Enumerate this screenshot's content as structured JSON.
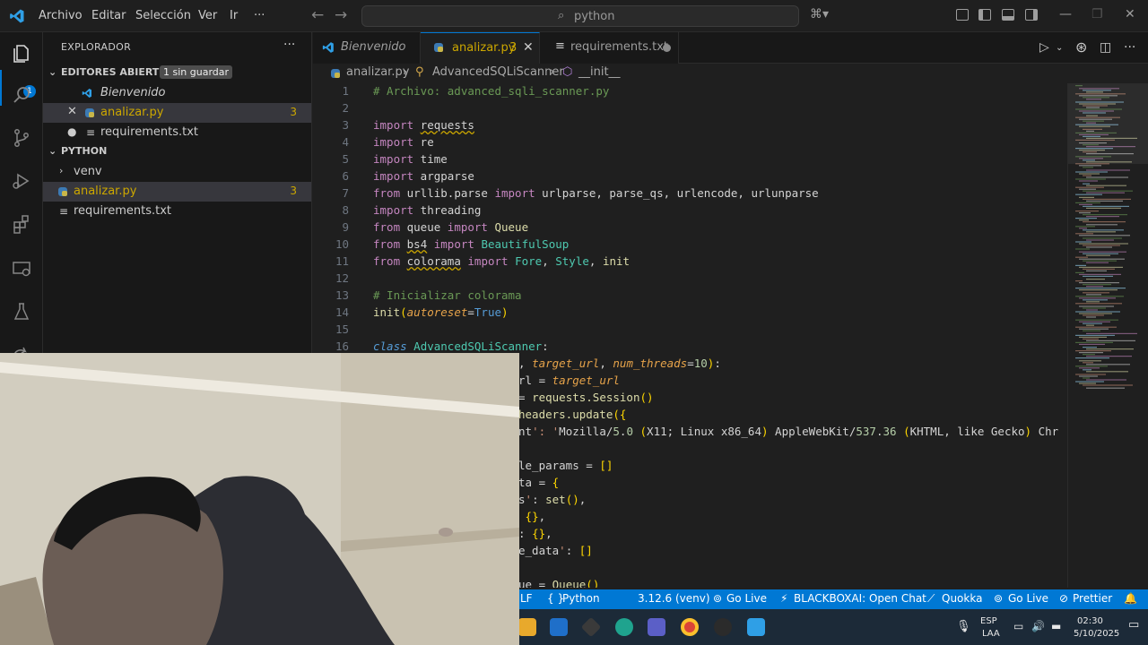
{
  "titlebar": {
    "menus": [
      "Archivo",
      "Editar",
      "Selección",
      "Ver",
      "Ir",
      "···"
    ],
    "search_text": "python"
  },
  "activitybar": {
    "explorer_badge": "1"
  },
  "sidebar": {
    "title": "EXPLORADOR",
    "open_editors": {
      "label": "EDITORES ABIERTOS",
      "dirty_badge": "1 sin guardar",
      "items": [
        {
          "name": "Bienvenido",
          "count": ""
        },
        {
          "name": "analizar.py",
          "count": "3"
        },
        {
          "name": "requirements.txt",
          "count": ""
        }
      ]
    },
    "folder": {
      "label": "PYTHON",
      "items": [
        {
          "name": "venv",
          "count": ""
        },
        {
          "name": "analizar.py",
          "count": "3"
        },
        {
          "name": "requirements.txt",
          "count": ""
        }
      ]
    }
  },
  "tabs": [
    {
      "label": "Bienvenido"
    },
    {
      "label": "analizar.py",
      "count": "3"
    },
    {
      "label": "requirements.txt"
    }
  ],
  "breadcrumb": {
    "file": "analizar.py",
    "class": "AdvancedSQLiScanner",
    "method": "__init__"
  },
  "editor": {
    "line_numbers": [
      "1",
      "2",
      "3",
      "4",
      "5",
      "6",
      "7",
      "8",
      "9",
      "10",
      "11",
      "12",
      "13",
      "14",
      "15",
      "16"
    ],
    "lines": [
      "# Archivo: advanced_sqli_scanner.py",
      "",
      "import requests",
      "import re",
      "import time",
      "import argparse",
      "from urllib.parse import urlparse, parse_qs, urlencode, urlunparse",
      "import threading",
      "from queue import Queue",
      "from bs4 import BeautifulSoup",
      "from colorama import Fore, Style, init",
      "",
      "# Inicializar colorama",
      "init(autoreset=True)",
      "",
      "class AdvancedSQLiScanner:",
      ", target_url, num_threads=10):",
      "rl = target_url",
      "= requests.Session()",
      "headers.update({",
      "nt': 'Mozilla/5.0 (X11; Linux x86_64) AppleWebKit/537.36 (KHTML, like Gecko) Chr",
      "",
      "le_params = []",
      "ta = {",
      "s': set(),",
      " {},",
      ": {},",
      "e_data': []",
      "",
      "ue = Queue()"
    ]
  },
  "statusbar": {
    "items": [
      "LF",
      "Python",
      "3.12.6 (venv)",
      "Go Live",
      "BLACKBOXAI: Open Chat",
      "Quokka",
      "Go Live",
      "Prettier"
    ]
  },
  "taskbar": {
    "lang": "ESP",
    "lang2": "LAA",
    "time": "02:30",
    "date": "5/10/2025"
  },
  "colors": {
    "accent": "#0078d4",
    "warning": "#cca700"
  }
}
